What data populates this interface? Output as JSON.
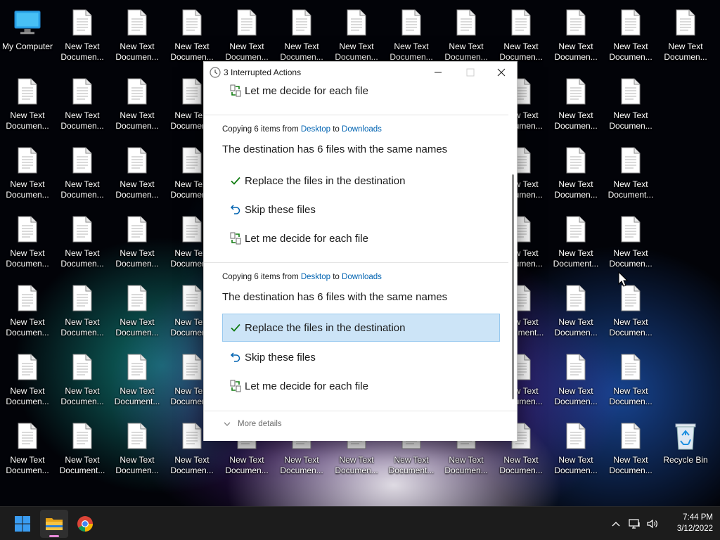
{
  "desktop": {
    "icons": [
      {
        "name": "my-computer",
        "label": "My Computer",
        "type": "pc"
      },
      {
        "name": "text-doc",
        "label": "New Text\nDocumen...",
        "type": "doc"
      },
      {
        "name": "recycle-bin",
        "label": "Recycle Bin",
        "type": "bin"
      }
    ],
    "doc_labels": {
      "short": "New Text\nDocumen...",
      "long": "New Text\nDocument..."
    }
  },
  "dialog": {
    "title": "3 Interrupted Actions",
    "options": {
      "replace": "Replace the files in the destination",
      "skip": "Skip these files",
      "decide": "Let me decide for each file"
    },
    "groups": [
      {
        "copy_prefix": "Copying 6 items from ",
        "from": "Desktop",
        "to_word": " to ",
        "to": "Downloads",
        "heading": "The destination has 6 files with the same names"
      },
      {
        "copy_prefix": "Copying 6 items from ",
        "from": "Desktop",
        "to_word": " to ",
        "to": "Downloads",
        "heading": "The destination has 6 files with the same names"
      }
    ],
    "more_details": "More details"
  },
  "taskbar": {
    "time": "7:44 PM",
    "date": "3/12/2022"
  },
  "colors": {
    "link": "#0063b1",
    "selected_bg": "#cce4f7",
    "check_green": "#107c10",
    "taskbar_bg": "#1c1c1c"
  }
}
